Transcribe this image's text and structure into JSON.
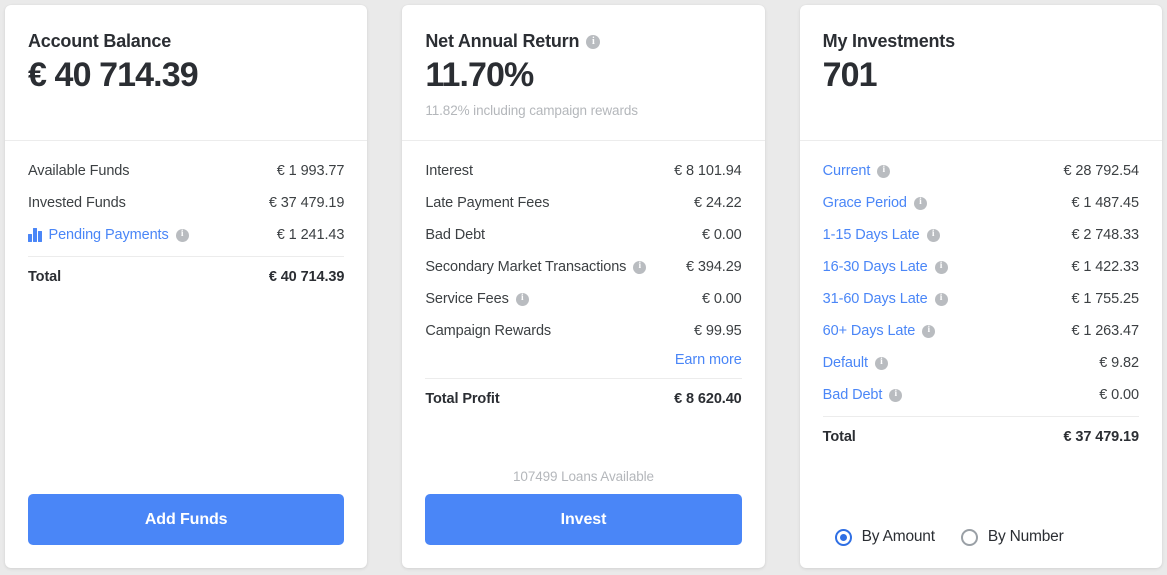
{
  "cards": [
    {
      "title": "Account Balance",
      "value": "€ 40 714.39",
      "rows": [
        {
          "label": "Available Funds",
          "value": "€ 1 993.77",
          "link": false,
          "info": false,
          "icon": ""
        },
        {
          "label": "Invested Funds",
          "value": "€ 37 479.19",
          "link": false,
          "info": false,
          "icon": ""
        },
        {
          "label": "Pending Payments",
          "value": "€ 1 241.43",
          "link": true,
          "info": true,
          "icon": "bar-chart-icon"
        }
      ],
      "total_label": "Total",
      "total_value": "€ 40 714.39",
      "cta_label": "Add Funds"
    },
    {
      "title": "Net Annual Return",
      "title_info": true,
      "value": "11.70%",
      "subtitle": "11.82% including campaign rewards",
      "rows": [
        {
          "label": "Interest",
          "value": "€ 8 101.94",
          "link": false,
          "info": false,
          "icon": ""
        },
        {
          "label": "Late Payment Fees",
          "value": "€ 24.22",
          "link": false,
          "info": false,
          "icon": ""
        },
        {
          "label": "Bad Debt",
          "value": "€ 0.00",
          "link": false,
          "info": false,
          "icon": ""
        },
        {
          "label": "Secondary Market Transactions",
          "value": "€ 394.29",
          "link": false,
          "info": true,
          "icon": ""
        },
        {
          "label": "Service Fees",
          "value": "€ 0.00",
          "link": false,
          "info": true,
          "icon": ""
        },
        {
          "label": "Campaign Rewards",
          "value": "€ 99.95",
          "link": false,
          "info": false,
          "icon": ""
        }
      ],
      "earn_more_label": "Earn more",
      "total_label": "Total Profit",
      "total_value": "€ 8 620.40",
      "loans_note": "107499 Loans Available",
      "cta_label": "Invest"
    },
    {
      "title": "My Investments",
      "value": "701",
      "rows": [
        {
          "label": "Current",
          "value": "€ 28 792.54",
          "link": true,
          "info": true,
          "icon": ""
        },
        {
          "label": "Grace Period",
          "value": "€ 1 487.45",
          "link": true,
          "info": true,
          "icon": ""
        },
        {
          "label": "1-15 Days Late",
          "value": "€ 2 748.33",
          "link": true,
          "info": true,
          "icon": ""
        },
        {
          "label": "16-30 Days Late",
          "value": "€ 1 422.33",
          "link": true,
          "info": true,
          "icon": ""
        },
        {
          "label": "31-60 Days Late",
          "value": "€ 1 755.25",
          "link": true,
          "info": true,
          "icon": ""
        },
        {
          "label": "60+ Days Late",
          "value": "€ 1 263.47",
          "link": true,
          "info": true,
          "icon": ""
        },
        {
          "label": "Default",
          "value": "€ 9.82",
          "link": true,
          "info": true,
          "icon": ""
        },
        {
          "label": "Bad Debt",
          "value": "€ 0.00",
          "link": true,
          "info": true,
          "icon": ""
        }
      ],
      "total_label": "Total",
      "total_value": "€ 37 479.19",
      "radio": {
        "options": [
          {
            "label": "By Amount",
            "selected": true
          },
          {
            "label": "By Number",
            "selected": false
          }
        ]
      }
    }
  ],
  "icons": {
    "info_glyph": "i"
  },
  "colors": {
    "accent_blue": "#4a86f7",
    "radio_blue": "#2f6fe4",
    "text_dark": "#2b2e33",
    "text_muted": "#b4b7bb",
    "background": "#eaeaea",
    "card": "#ffffff",
    "divider": "#ececec"
  }
}
